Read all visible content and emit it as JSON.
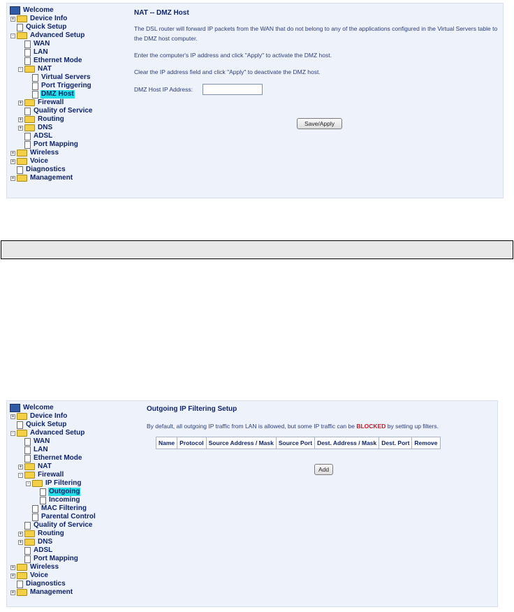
{
  "screen1": {
    "tree": [
      {
        "label": "Welcome",
        "icon": "monitor-icon",
        "depth": 0,
        "expander": "",
        "selected": false
      },
      {
        "label": "Device Info",
        "icon": "folder-icon",
        "depth": 1,
        "expander": "+",
        "selected": false
      },
      {
        "label": "Quick Setup",
        "icon": "page-icon",
        "depth": 1,
        "expander": "",
        "selected": false
      },
      {
        "label": "Advanced Setup",
        "icon": "folder-icon",
        "depth": 1,
        "expander": "-",
        "selected": false
      },
      {
        "label": "WAN",
        "icon": "page-icon",
        "depth": 2,
        "expander": "",
        "selected": false
      },
      {
        "label": "LAN",
        "icon": "page-icon",
        "depth": 2,
        "expander": "",
        "selected": false
      },
      {
        "label": "Ethernet Mode",
        "icon": "page-icon",
        "depth": 2,
        "expander": "",
        "selected": false
      },
      {
        "label": "NAT",
        "icon": "folder-icon",
        "depth": 2,
        "expander": "-",
        "selected": false
      },
      {
        "label": "Virtual Servers",
        "icon": "page-icon",
        "depth": 3,
        "expander": "",
        "selected": false
      },
      {
        "label": "Port Triggering",
        "icon": "page-icon",
        "depth": 3,
        "expander": "",
        "selected": false
      },
      {
        "label": "DMZ Host",
        "icon": "page-icon",
        "depth": 3,
        "expander": "",
        "selected": true
      },
      {
        "label": "Firewall",
        "icon": "folder-icon",
        "depth": 2,
        "expander": "+",
        "selected": false
      },
      {
        "label": "Quality of Service",
        "icon": "page-icon",
        "depth": 2,
        "expander": "",
        "selected": false
      },
      {
        "label": "Routing",
        "icon": "folder-icon",
        "depth": 2,
        "expander": "+",
        "selected": false
      },
      {
        "label": "DNS",
        "icon": "folder-icon",
        "depth": 2,
        "expander": "+",
        "selected": false
      },
      {
        "label": "ADSL",
        "icon": "page-icon",
        "depth": 2,
        "expander": "",
        "selected": false
      },
      {
        "label": "Port Mapping",
        "icon": "page-icon",
        "depth": 2,
        "expander": "",
        "selected": false
      },
      {
        "label": "Wireless",
        "icon": "folder-icon",
        "depth": 1,
        "expander": "+",
        "selected": false
      },
      {
        "label": "Voice",
        "icon": "folder-icon",
        "depth": 1,
        "expander": "+",
        "selected": false
      },
      {
        "label": "Diagnostics",
        "icon": "page-icon",
        "depth": 1,
        "expander": "",
        "selected": false
      },
      {
        "label": "Management",
        "icon": "folder-icon",
        "depth": 1,
        "expander": "+",
        "selected": false
      }
    ],
    "title": "NAT -- DMZ Host",
    "para1": "The DSL router will forward IP packets from the WAN that do not belong to any of the applications configured in the Virtual Servers table to the DMZ host computer.",
    "para2": "Enter the computer's IP address and click \"Apply\" to activate the DMZ host.",
    "para3": "Clear the IP address field and click \"Apply\" to deactivate the DMZ host.",
    "dmz_label": "DMZ Host IP Address:",
    "dmz_value": "",
    "save_label": "Save/Apply"
  },
  "screen2": {
    "tree": [
      {
        "label": "Welcome",
        "icon": "monitor-icon",
        "depth": 0,
        "expander": "",
        "selected": false
      },
      {
        "label": "Device Info",
        "icon": "folder-icon",
        "depth": 1,
        "expander": "+",
        "selected": false
      },
      {
        "label": "Quick Setup",
        "icon": "page-icon",
        "depth": 1,
        "expander": "",
        "selected": false
      },
      {
        "label": "Advanced Setup",
        "icon": "folder-icon",
        "depth": 1,
        "expander": "-",
        "selected": false
      },
      {
        "label": "WAN",
        "icon": "page-icon",
        "depth": 2,
        "expander": "",
        "selected": false
      },
      {
        "label": "LAN",
        "icon": "page-icon",
        "depth": 2,
        "expander": "",
        "selected": false
      },
      {
        "label": "Ethernet Mode",
        "icon": "page-icon",
        "depth": 2,
        "expander": "",
        "selected": false
      },
      {
        "label": "NAT",
        "icon": "folder-icon",
        "depth": 2,
        "expander": "+",
        "selected": false
      },
      {
        "label": "Firewall",
        "icon": "folder-icon",
        "depth": 2,
        "expander": "-",
        "selected": false
      },
      {
        "label": "IP Filtering",
        "icon": "folder-icon",
        "depth": 3,
        "expander": "-",
        "selected": false
      },
      {
        "label": "Outgoing",
        "icon": "page-icon",
        "depth": 4,
        "expander": "",
        "selected": true
      },
      {
        "label": "Incoming",
        "icon": "page-icon",
        "depth": 4,
        "expander": "",
        "selected": false
      },
      {
        "label": "MAC Filtering",
        "icon": "page-icon",
        "depth": 3,
        "expander": "",
        "selected": false
      },
      {
        "label": "Parental Control",
        "icon": "page-icon",
        "depth": 3,
        "expander": "",
        "selected": false
      },
      {
        "label": "Quality of Service",
        "icon": "page-icon",
        "depth": 2,
        "expander": "",
        "selected": false
      },
      {
        "label": "Routing",
        "icon": "folder-icon",
        "depth": 2,
        "expander": "+",
        "selected": false
      },
      {
        "label": "DNS",
        "icon": "folder-icon",
        "depth": 2,
        "expander": "+",
        "selected": false
      },
      {
        "label": "ADSL",
        "icon": "page-icon",
        "depth": 2,
        "expander": "",
        "selected": false
      },
      {
        "label": "Port Mapping",
        "icon": "page-icon",
        "depth": 2,
        "expander": "",
        "selected": false
      },
      {
        "label": "Wireless",
        "icon": "folder-icon",
        "depth": 1,
        "expander": "+",
        "selected": false
      },
      {
        "label": "Voice",
        "icon": "folder-icon",
        "depth": 1,
        "expander": "+",
        "selected": false
      },
      {
        "label": "Diagnostics",
        "icon": "page-icon",
        "depth": 1,
        "expander": "",
        "selected": false
      },
      {
        "label": "Management",
        "icon": "folder-icon",
        "depth": 1,
        "expander": "+",
        "selected": false
      }
    ],
    "title": "Outgoing IP Filtering Setup",
    "desc_before": "By default, all outgoing IP traffic from LAN is allowed, but some IP traffic can be ",
    "desc_blocked": "BLOCKED",
    "desc_after": " by setting up filters.",
    "table_headers": [
      "Name",
      "Protocol",
      "Source Address / Mask",
      "Source Port",
      "Dest. Address / Mask",
      "Dest. Port",
      "Remove"
    ],
    "add_label": "Add"
  },
  "colors": {
    "selected_highlight": "#22e0e8",
    "blocked_text": "#d6121a",
    "tree_text": "#10246a",
    "panel_background": "#eef2fb"
  }
}
